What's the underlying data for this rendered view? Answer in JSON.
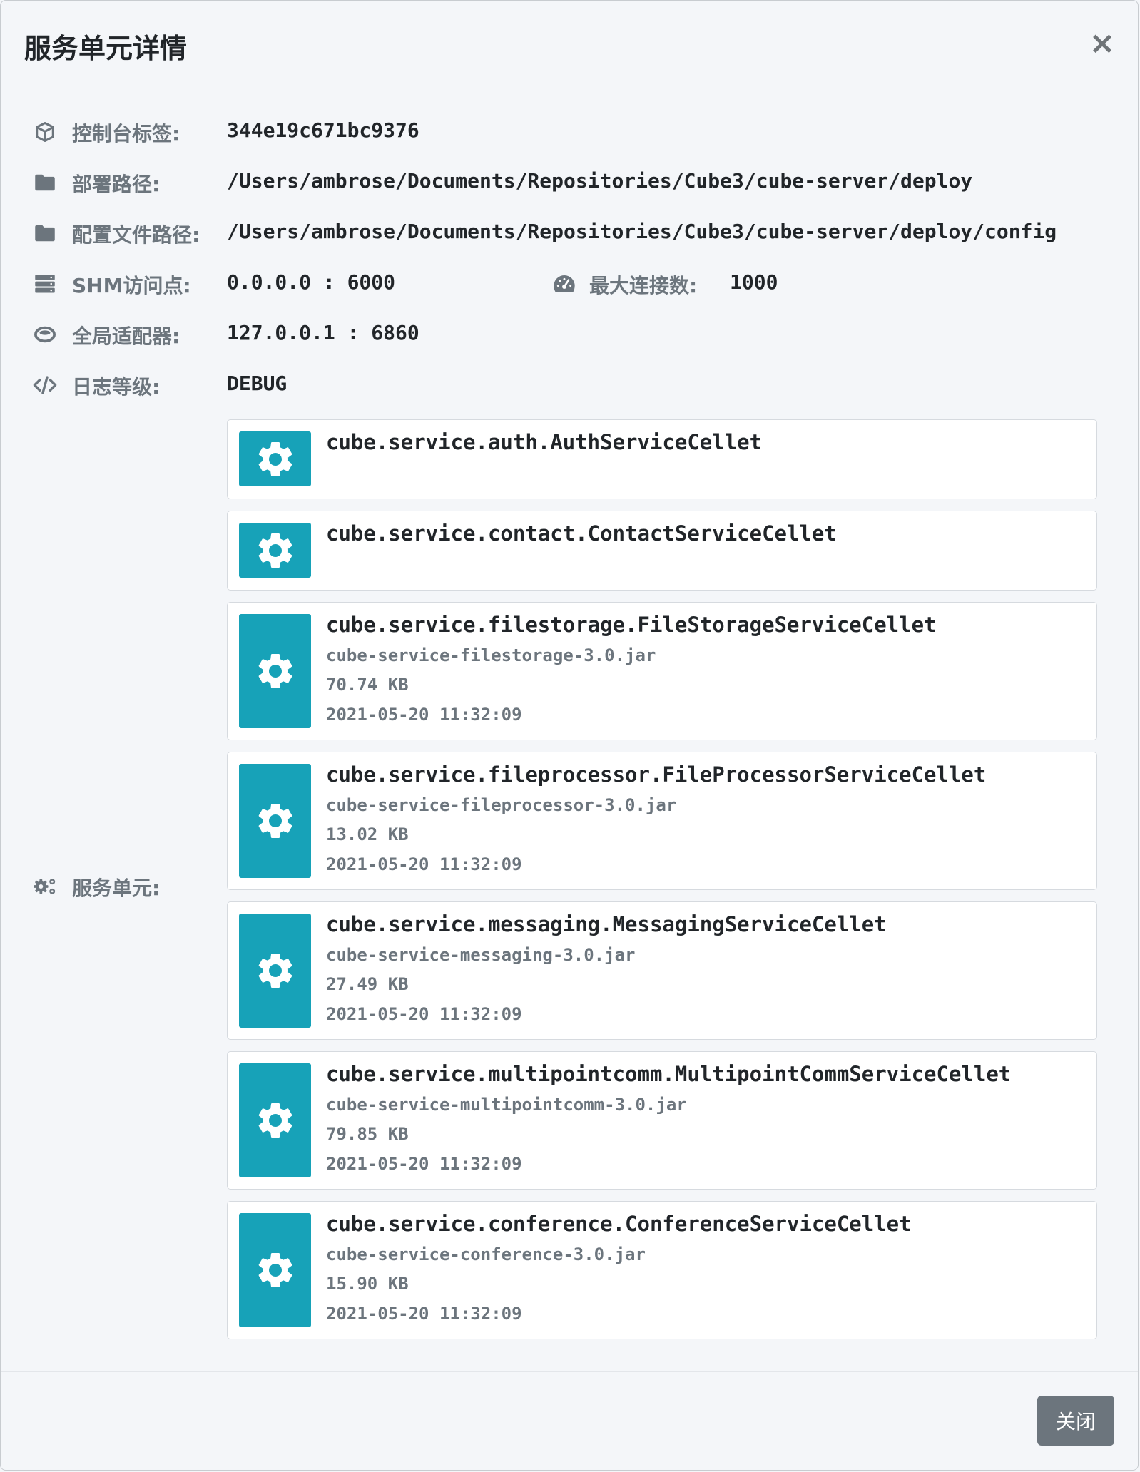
{
  "modal": {
    "title": "服务单元详情",
    "close_symbol": "×",
    "close_button_label": "关闭"
  },
  "details": {
    "console_tag": {
      "icon": "cube-icon",
      "label": "控制台标签:",
      "value": "344e19c671bc9376"
    },
    "deploy_path": {
      "icon": "folder-icon",
      "label": "部署路径:",
      "value": "/Users/ambrose/Documents/Repositories/Cube3/cube-server/deploy"
    },
    "config_path": {
      "icon": "folder-icon",
      "label": "配置文件路径:",
      "value": "/Users/ambrose/Documents/Repositories/Cube3/cube-server/deploy/config"
    },
    "shm_endpoint": {
      "icon": "server-icon",
      "label": "SHM访问点:",
      "value": "0.0.0.0 : 6000"
    },
    "max_connections": {
      "icon": "gauge-icon",
      "label": "最大连接数:",
      "value": "1000"
    },
    "global_adapter": {
      "icon": "ring-icon",
      "label": "全局适配器:",
      "value": "127.0.0.1 : 6860"
    },
    "log_level": {
      "icon": "code-icon",
      "label": "日志等级:",
      "value": "DEBUG"
    },
    "service_units_label": {
      "icon": "cogs-icon",
      "label": "服务单元:"
    }
  },
  "cellets": [
    {
      "name": "cube.service.auth.AuthServiceCellet",
      "jar": "",
      "size": "",
      "date": ""
    },
    {
      "name": "cube.service.contact.ContactServiceCellet",
      "jar": "",
      "size": "",
      "date": ""
    },
    {
      "name": "cube.service.filestorage.FileStorageServiceCellet",
      "jar": "cube-service-filestorage-3.0.jar",
      "size": "70.74 KB",
      "date": "2021-05-20 11:32:09"
    },
    {
      "name": "cube.service.fileprocessor.FileProcessorServiceCellet",
      "jar": "cube-service-fileprocessor-3.0.jar",
      "size": "13.02 KB",
      "date": "2021-05-20 11:32:09"
    },
    {
      "name": "cube.service.messaging.MessagingServiceCellet",
      "jar": "cube-service-messaging-3.0.jar",
      "size": "27.49 KB",
      "date": "2021-05-20 11:32:09"
    },
    {
      "name": "cube.service.multipointcomm.MultipointCommServiceCellet",
      "jar": "cube-service-multipointcomm-3.0.jar",
      "size": "79.85 KB",
      "date": "2021-05-20 11:32:09"
    },
    {
      "name": "cube.service.conference.ConferenceServiceCellet",
      "jar": "cube-service-conference-3.0.jar",
      "size": "15.90 KB",
      "date": "2021-05-20 11:32:09"
    }
  ],
  "colors": {
    "tile": "#17a2b8",
    "muted": "#6c757d",
    "text": "#212529"
  }
}
